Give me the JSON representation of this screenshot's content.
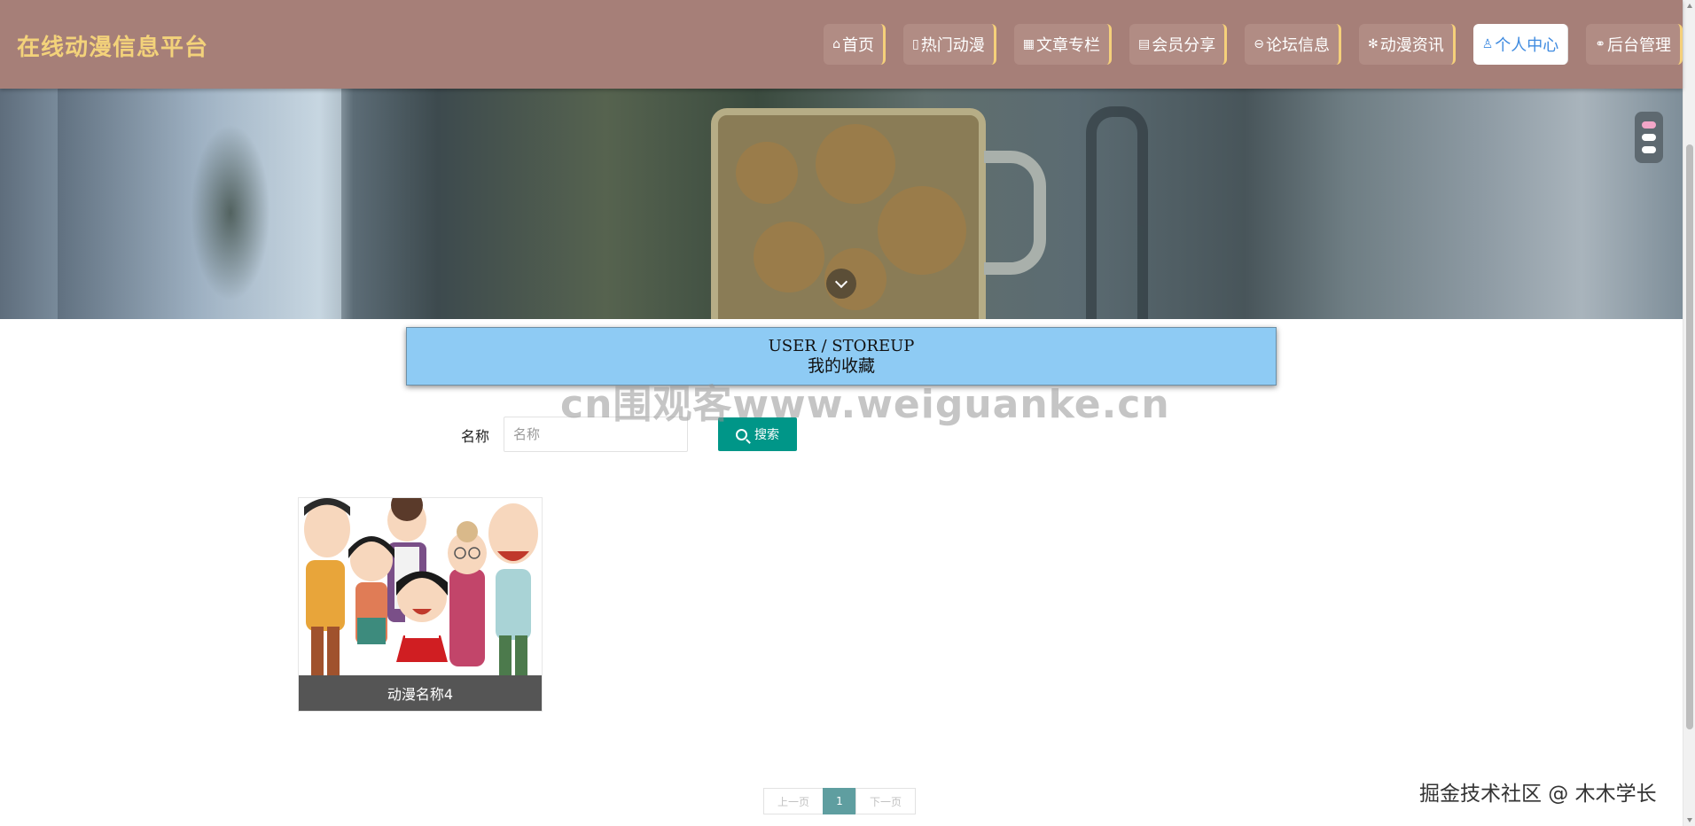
{
  "header": {
    "brand": "在线动漫信息平台",
    "nav": [
      {
        "icon": "home-icon",
        "glyph": "⌂",
        "label": "首页"
      },
      {
        "icon": "hot-icon",
        "glyph": "▯",
        "label": "热门动漫"
      },
      {
        "icon": "article-icon",
        "glyph": "▦",
        "label": "文章专栏"
      },
      {
        "icon": "share-icon",
        "glyph": "▤",
        "label": "会员分享"
      },
      {
        "icon": "forum-icon",
        "glyph": "⊖",
        "label": "论坛信息"
      },
      {
        "icon": "news-icon",
        "glyph": "✻",
        "label": "动漫资讯"
      },
      {
        "icon": "user-icon",
        "glyph": "♙",
        "label": "个人中心"
      },
      {
        "icon": "link-icon",
        "glyph": "⚭",
        "label": "后台管理"
      }
    ],
    "active_index": 6
  },
  "section": {
    "title_en": "USER / STOREUP",
    "title_cn": "我的收藏"
  },
  "watermark": "cn围观客www.weiguanke.cn",
  "search": {
    "label": "名称",
    "placeholder": "名称",
    "value": "",
    "button": "搜索"
  },
  "items": [
    {
      "name": "动漫名称4"
    }
  ],
  "pagination": {
    "prev": "上一页",
    "current": "1",
    "next": "下一页"
  },
  "credit": "掘金技术社区 @ 木木学长",
  "colors": {
    "header": "#a67f78",
    "brand": "#f3d27a",
    "nav_accent": "#f5d07a",
    "section_title_bg": "#8ecbf4",
    "search_button": "#009688",
    "pager_current": "#5f9ea0"
  }
}
